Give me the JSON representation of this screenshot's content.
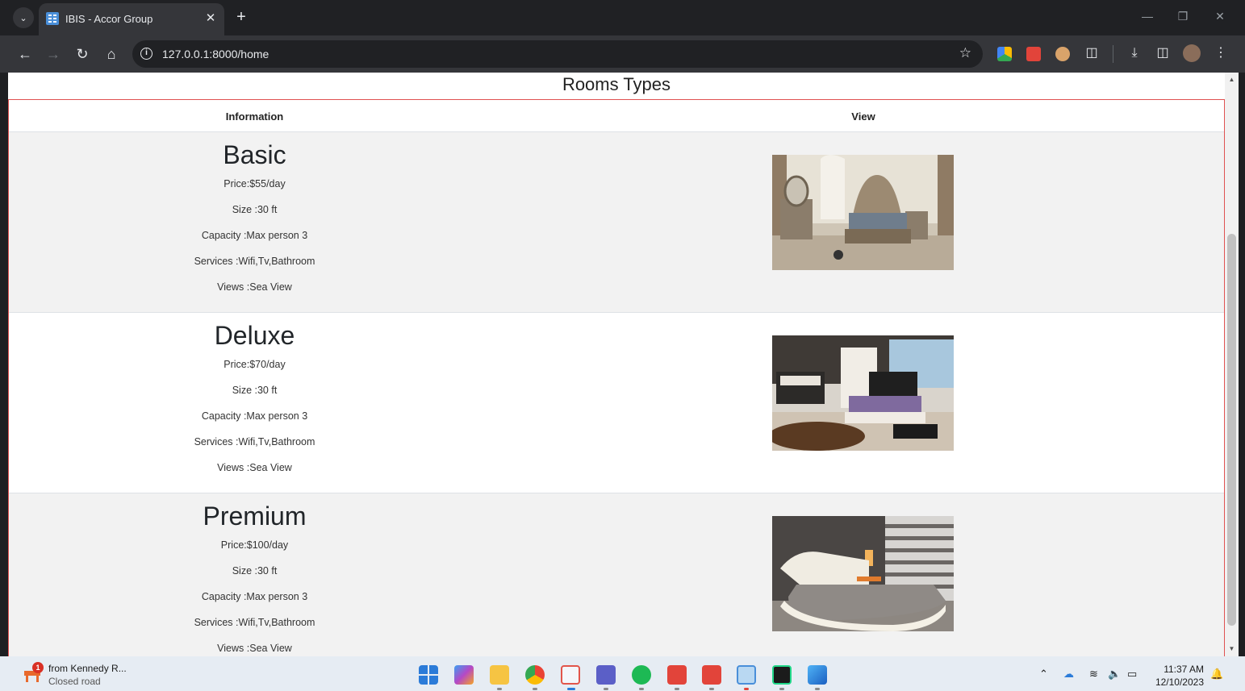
{
  "browser": {
    "tab_title": "IBIS - Accor Group",
    "url": "127.0.0.1:8000/home"
  },
  "page": {
    "title": "Rooms Types",
    "columns": {
      "information": "Information",
      "view": "View"
    },
    "rooms": [
      {
        "name": "Basic",
        "price": "Price:$55/day",
        "size": "Size :30 ft",
        "capacity": "Capacity :Max person 3",
        "services": "Services :Wifi,Tv,Bathroom",
        "views": "Views :Sea View"
      },
      {
        "name": "Deluxe",
        "price": "Price:$70/day",
        "size": "Size :30 ft",
        "capacity": "Capacity :Max person 3",
        "services": "Services :Wifi,Tv,Bathroom",
        "views": "Views :Sea View"
      },
      {
        "name": "Premium",
        "price": "Price:$100/day",
        "size": "Size :30 ft",
        "capacity": "Capacity :Max person 3",
        "services": "Services :Wifi,Tv,Bathroom",
        "views": "Views :Sea View"
      }
    ]
  },
  "taskbar": {
    "notification": {
      "badge": "1",
      "title": "from Kennedy R...",
      "subtitle": "Closed road"
    },
    "clock": {
      "time": "11:37 AM",
      "date": "12/10/2023"
    }
  },
  "colors": {
    "table_border": "#e05252",
    "stripe": "#f2f2f2"
  }
}
